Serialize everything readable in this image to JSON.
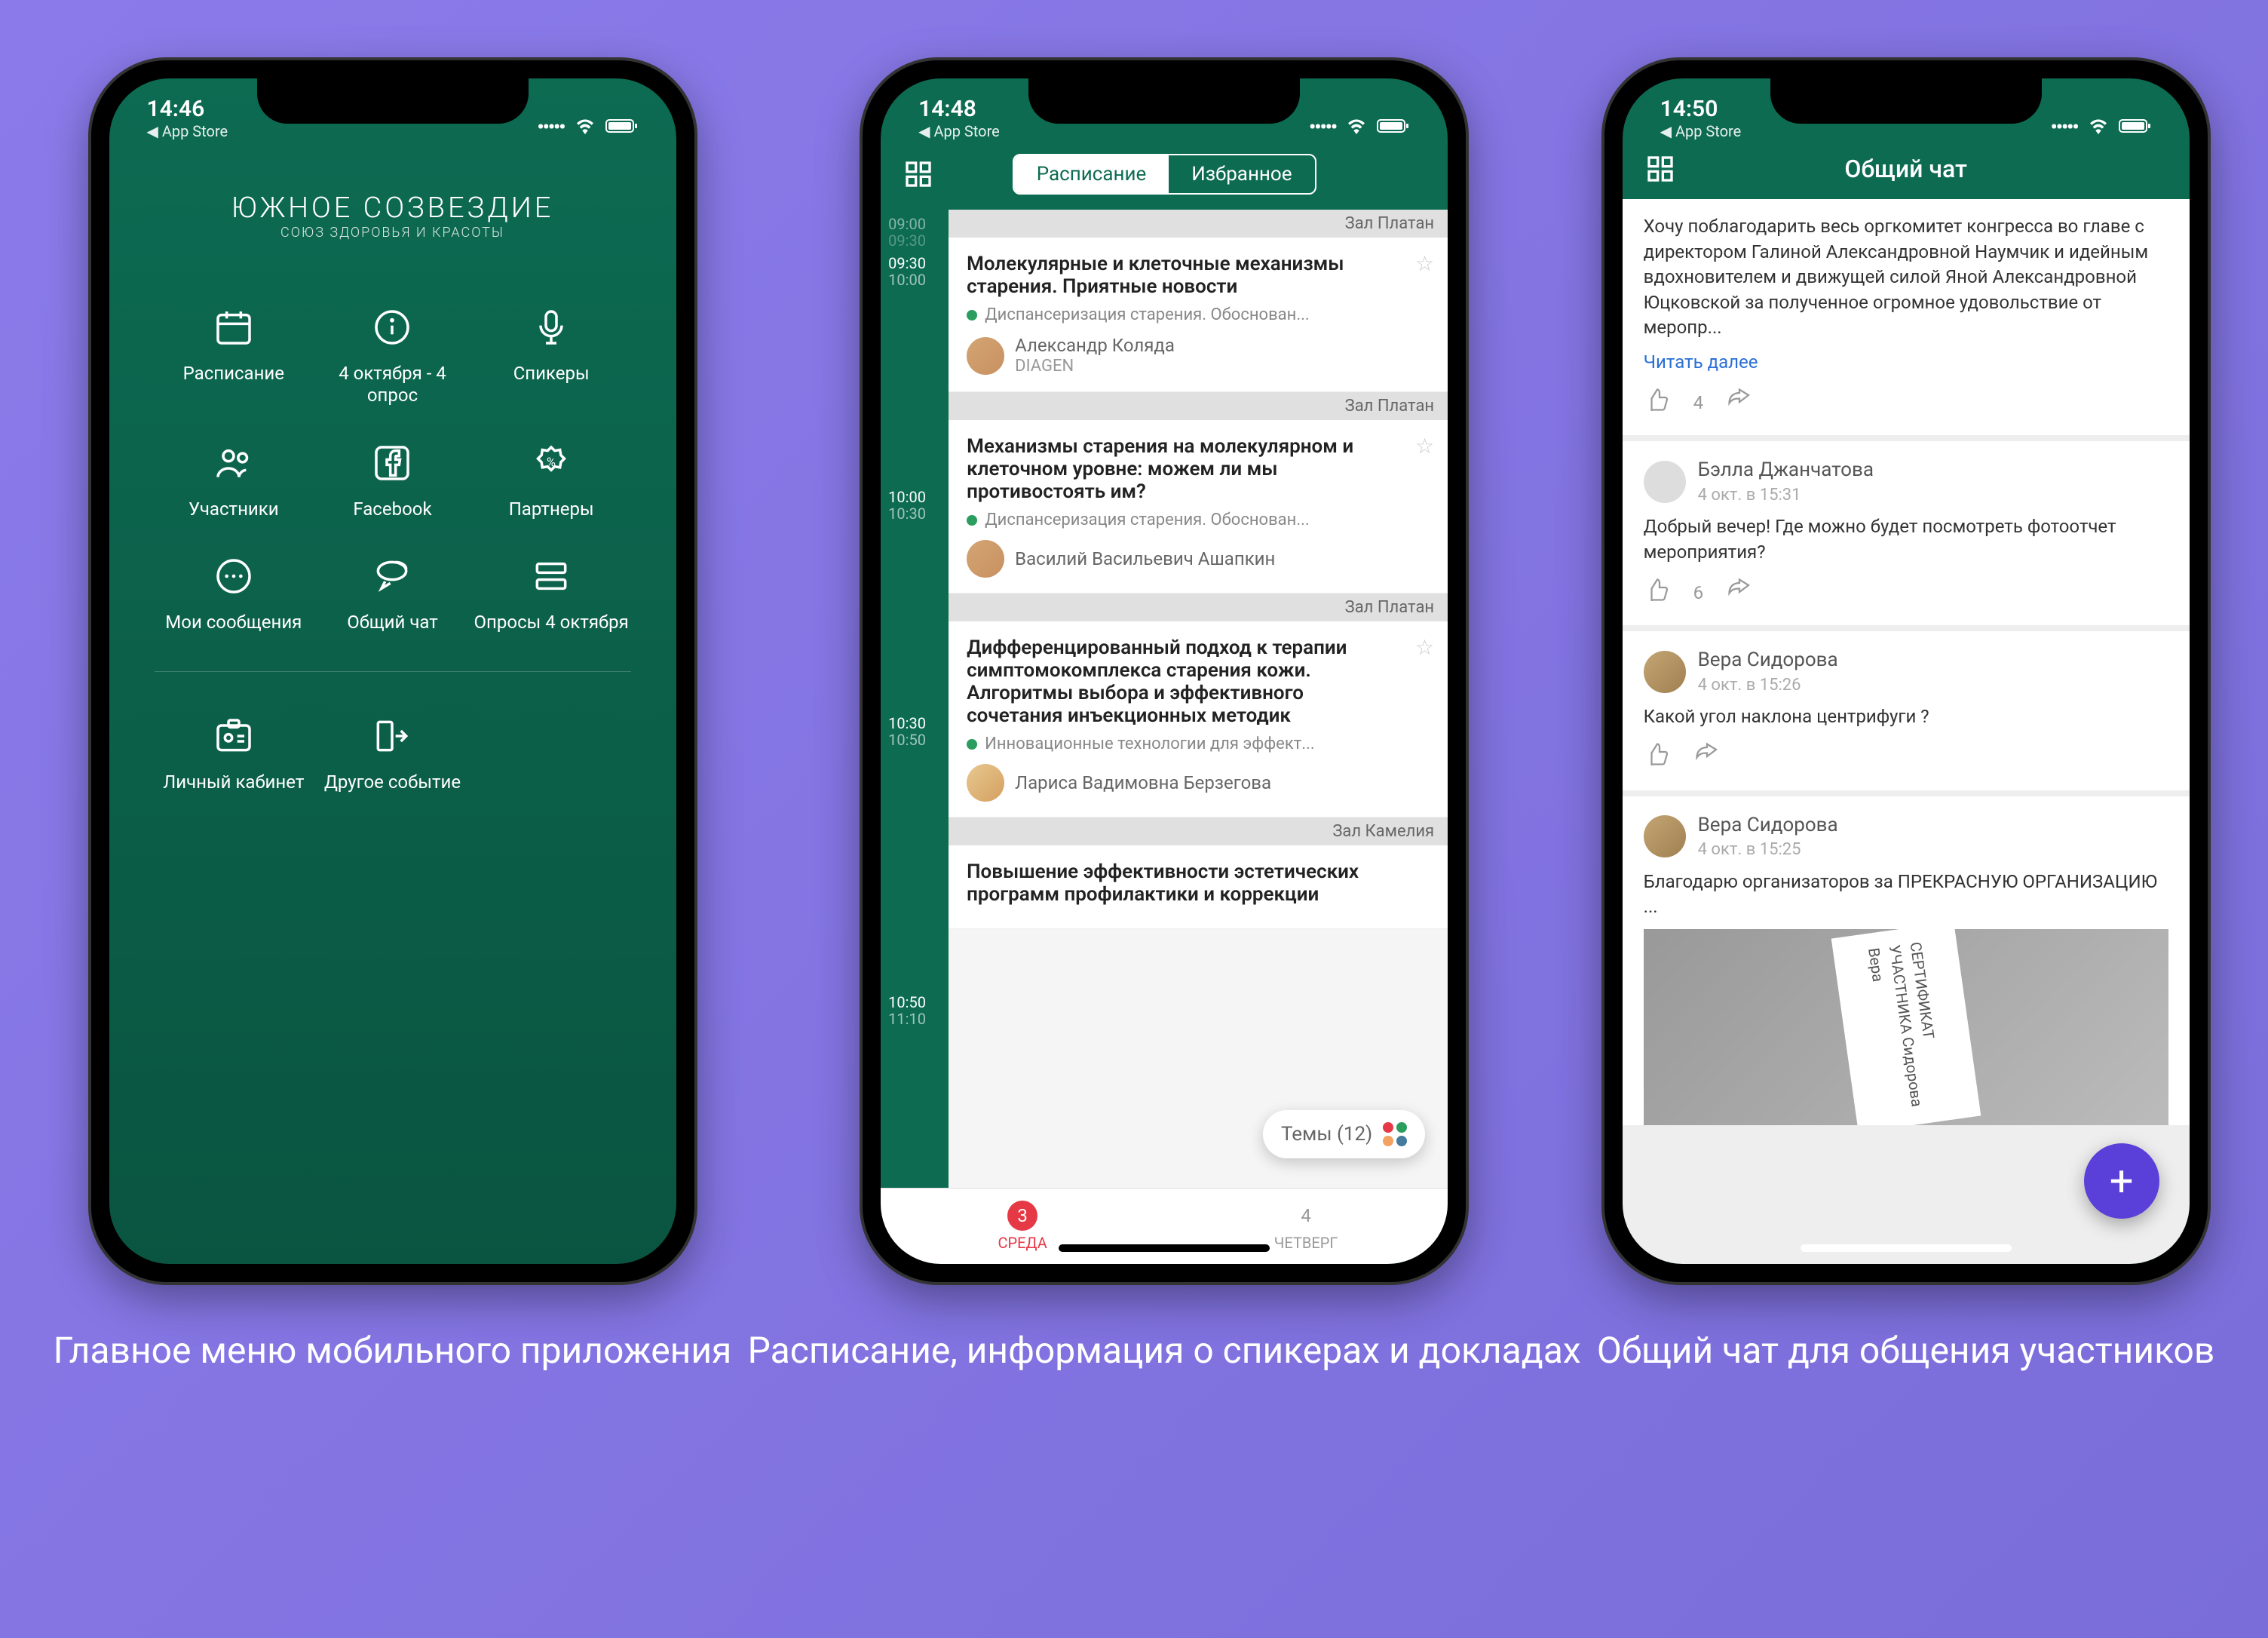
{
  "status": {
    "back": "◀ App Store"
  },
  "phone1": {
    "time": "14:46",
    "logo_line1": "ЮЖНОЕ СОЗВЕЗДИЕ",
    "logo_line2": "СОЮЗ ЗДОРОВЬЯ И КРАСОТЫ",
    "menu": {
      "schedule": "Расписание",
      "polls_today": "4 октября - 4 опрос",
      "speakers": "Спикеры",
      "participants": "Участники",
      "facebook": "Facebook",
      "partners": "Партнеры",
      "my_messages": "Мои сообщения",
      "chat": "Общий чат",
      "polls": "Опросы 4 октября",
      "profile": "Личный кабинет",
      "other_event": "Другое событие"
    }
  },
  "phone2": {
    "time": "14:48",
    "tabs": {
      "schedule": "Расписание",
      "favorites": "Избранное"
    },
    "themes_label": "Темы (12)",
    "rooms": {
      "platan": "Зал Платан",
      "camelia": "Зал Камелия"
    },
    "days": [
      {
        "num": "3",
        "name": "СРЕДА",
        "active": true
      },
      {
        "num": "4",
        "name": "ЧЕТВЕРГ",
        "active": false
      }
    ],
    "slots": [
      {
        "start": "09:00",
        "end": "09:30"
      },
      {
        "start": "09:30",
        "end": "10:00"
      },
      {
        "start": "10:00",
        "end": "10:30"
      },
      {
        "start": "10:30",
        "end": "10:50"
      },
      {
        "start": "10:50",
        "end": "11:10"
      }
    ],
    "events": [
      {
        "title": "Молекулярные и клеточные механизмы старения. Приятные новости",
        "track": "Диспансеризация старения. Обоснован...",
        "speaker": "Александр Коляда",
        "company": "DIAGEN"
      },
      {
        "title": "Механизмы старения на молекулярном и клеточном уровне: можем ли мы противостоять им?",
        "track": "Диспансеризация старения. Обоснован...",
        "speaker": "Василий Васильевич Ашапкин",
        "company": ""
      },
      {
        "title": "Дифференцированный подход к терапии симптомокомплекса старения кожи. Алгоритмы выбора и эффективного сочетания инъекционных методик",
        "track": "Инновационные технологии для эффект...",
        "speaker": "Лариса Вадимовна Берзегова",
        "company": ""
      },
      {
        "title": "Повышение эффективности эстетических программ профилактики и коррекции",
        "track": "",
        "speaker": "",
        "company": ""
      }
    ]
  },
  "phone3": {
    "time": "14:50",
    "title": "Общий чат",
    "read_more": "Читать далее",
    "messages": [
      {
        "text": "Хочу поблагодарить весь оргкомитет конгресса во главе с директором Галиной Александровной Наумчик и идейным вдохновителем и движущей силой Яной Александровной Юцковской за полученное огромное удовольствие от меропр...",
        "likes": "4"
      },
      {
        "user": "Бэлла Джанчатова",
        "time": "4 окт. в 15:31",
        "text": "Добрый вечер! Где можно будет посмотреть фотоотчет мероприятия?",
        "likes": "6"
      },
      {
        "user": "Вера Сидорова",
        "time": "4 окт. в 15:26",
        "text": "Какой угол наклона центрифуги ?",
        "likes": ""
      },
      {
        "user": "Вера Сидорова",
        "time": "4 окт. в 15:25",
        "text": "Благодарю организаторов за ПРЕКРАСНУЮ ОРГАНИЗАЦИЮ ...",
        "likes": ""
      }
    ],
    "cert_text": "СЕРТИФИКАТ УЧАСТНИКА Сидорова Вера"
  },
  "captions": {
    "c1": "Главное меню мобильного приложения",
    "c2": "Расписание, информация о спикерах и докладах",
    "c3": "Общий чат для общения участников"
  }
}
